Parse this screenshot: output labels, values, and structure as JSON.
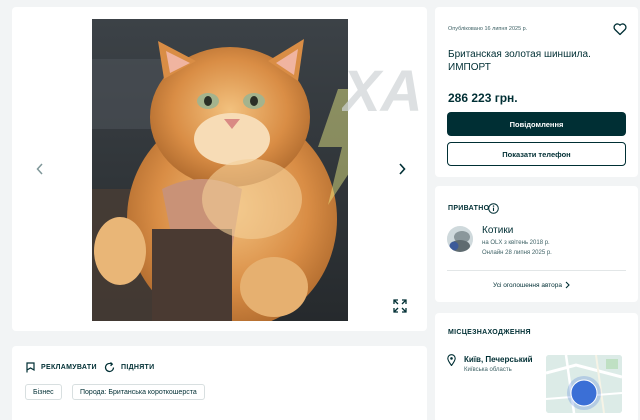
{
  "gallery": {
    "photo_alt": "Британская золотая шиншила",
    "watermark": "ХА"
  },
  "actions": {
    "promote_label": "РЕКЛАМУВАТИ",
    "raise_label": "ПІДНЯТИ"
  },
  "tags": [
    "Бізнес",
    "Порода: Британська короткошерста"
  ],
  "listing": {
    "published": "Опубліковано 16 липня 2025 р.",
    "title": "Британская золотая шиншила. ИМПОРТ",
    "price": "286 223 грн.",
    "message_button": "Повідомлення",
    "phone_button": "Показати телефон"
  },
  "seller": {
    "type_label": "ПРИВАТНО",
    "name": "Котики",
    "since": "на OLX з квітень 2018 р.",
    "online": "Онлайн 28 липня 2025 р.",
    "all_ads": "Усі оголошення автора"
  },
  "location": {
    "heading": "МІСЦЕЗНАХОДЖЕННЯ",
    "city": "Київ, Печерський",
    "region": "Київська область"
  },
  "colors": {
    "primary": "#002f34",
    "background": "#f2f4f5",
    "map_accent": "#3b6fd6"
  },
  "icons": [
    "chevron-left-icon",
    "chevron-right-icon",
    "expand-icon",
    "heart-icon",
    "info-icon",
    "flag-icon",
    "refresh-icon",
    "map-pin-icon",
    "chevron-right-small-icon"
  ]
}
